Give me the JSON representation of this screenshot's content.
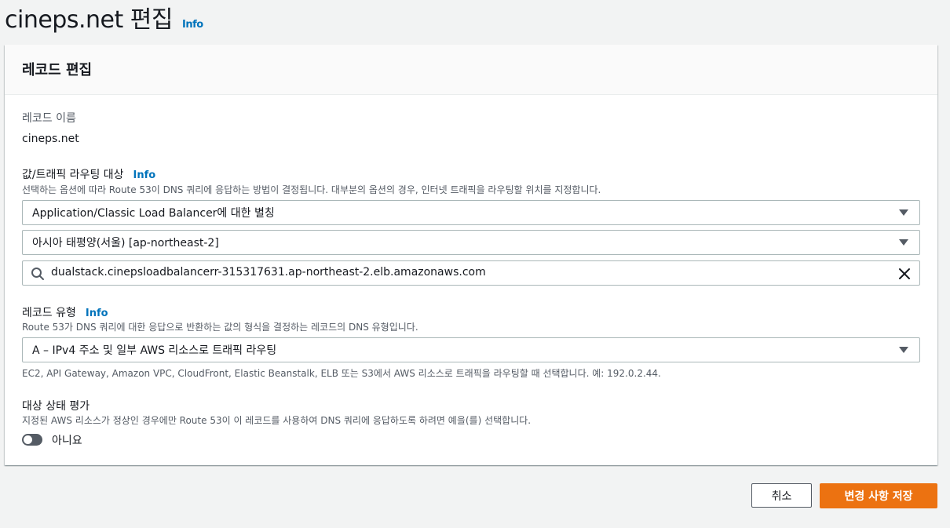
{
  "page": {
    "title": "cineps.net 편집",
    "info_label": "Info"
  },
  "panel": {
    "header": "레코드 편집",
    "record_name": {
      "label": "레코드 이름",
      "value": "cineps.net"
    },
    "routing_target": {
      "label": "값/트래픽 라우팅 대상",
      "info_label": "Info",
      "description": "선택하는 옵션에 따라 Route 53이 DNS 쿼리에 응답하는 방법이 결정됩니다. 대부분의 옵션의 경우, 인터넷 트래픽을 라우팅할 위치를 지정합니다.",
      "endpoint_select": "Application/Classic Load Balancer에 대한 별칭",
      "region_select": "아시아 태평양(서울) [ap-northeast-2]",
      "load_balancer_value": "dualstack.cinepsloadbalancerr-315317631.ap-northeast-2.elb.amazonaws.com"
    },
    "record_type": {
      "label": "레코드 유형",
      "info_label": "Info",
      "description": "Route 53가 DNS 쿼리에 대한 응답으로 반환하는 값의 형식을 결정하는 레코드의 DNS 유형입니다.",
      "selected": "A – IPv4 주소 및 일부 AWS 리소스로 트래픽 라우팅",
      "hint": "EC2, API Gateway, Amazon VPC, CloudFront, Elastic Beanstalk, ELB 또는 S3에서 AWS 리소스로 트래픽을 라우팅할 때 선택합니다. 예: 192.0.2.44."
    },
    "health_check": {
      "label": "대상 상태 평가",
      "description": "지정된 AWS 리소스가 정상인 경우에만 Route 53이 이 레코드를 사용하여 DNS 쿼리에 응답하도록 하려면 예을(를) 선택합니다.",
      "toggle_state": "아니요"
    }
  },
  "actions": {
    "cancel_label": "취소",
    "save_label": "변경 사항 저장"
  },
  "colors": {
    "primary_button": "#ec7211",
    "link": "#0073bb",
    "background": "#f2f3f3"
  },
  "icons": {
    "search": "search-icon",
    "clear": "close-icon",
    "caret": "caret-down-icon"
  }
}
